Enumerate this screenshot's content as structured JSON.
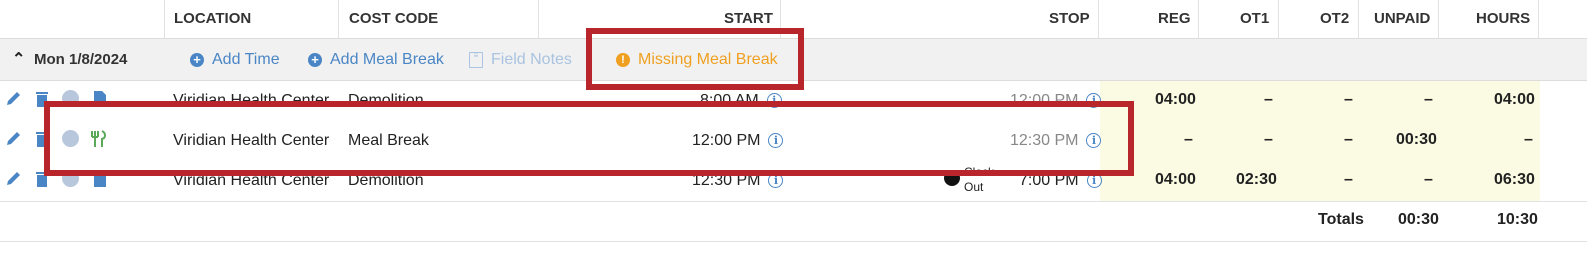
{
  "header": {
    "location": "LOCATION",
    "cost_code": "COST CODE",
    "start": "START",
    "stop": "STOP",
    "reg": "REG",
    "ot1": "OT1",
    "ot2": "OT2",
    "unpaid": "UNPAID",
    "hours": "HOURS"
  },
  "day": {
    "label": "Mon 1/8/2024",
    "add_time": "Add Time",
    "add_meal_break": "Add Meal Break",
    "field_notes": "Field Notes",
    "missing_meal_break": "Missing Meal Break"
  },
  "rows": [
    {
      "location": "Viridian Health Center",
      "cost_code": "Demolition",
      "start": "8:00 AM",
      "stop": "12:00 PM",
      "reg": "04:00",
      "ot1": "–",
      "ot2": "–",
      "unpaid": "–",
      "hours": "04:00",
      "tag": ""
    },
    {
      "location": "Viridian Health Center",
      "cost_code": "Meal Break",
      "start": "12:00 PM",
      "stop": "12:30 PM",
      "reg": "–",
      "ot1": "–",
      "ot2": "–",
      "unpaid": "00:30",
      "hours": "–",
      "tag": ""
    },
    {
      "location": "Viridian Health Center",
      "cost_code": "Demolition",
      "start": "12:30 PM",
      "stop": "7:00 PM",
      "reg": "04:00",
      "ot1": "02:30",
      "ot2": "–",
      "unpaid": "–",
      "hours": "06:30",
      "tag_line1": "Clock",
      "tag_line2": "Out"
    }
  ],
  "totals": {
    "label": "Totals",
    "unpaid": "00:30",
    "hours": "10:30"
  },
  "colors": {
    "accent": "#4a86c5",
    "warning": "#f0a020",
    "highlight_box": "#b8262c",
    "hours_bg": "#fbfbe3"
  }
}
